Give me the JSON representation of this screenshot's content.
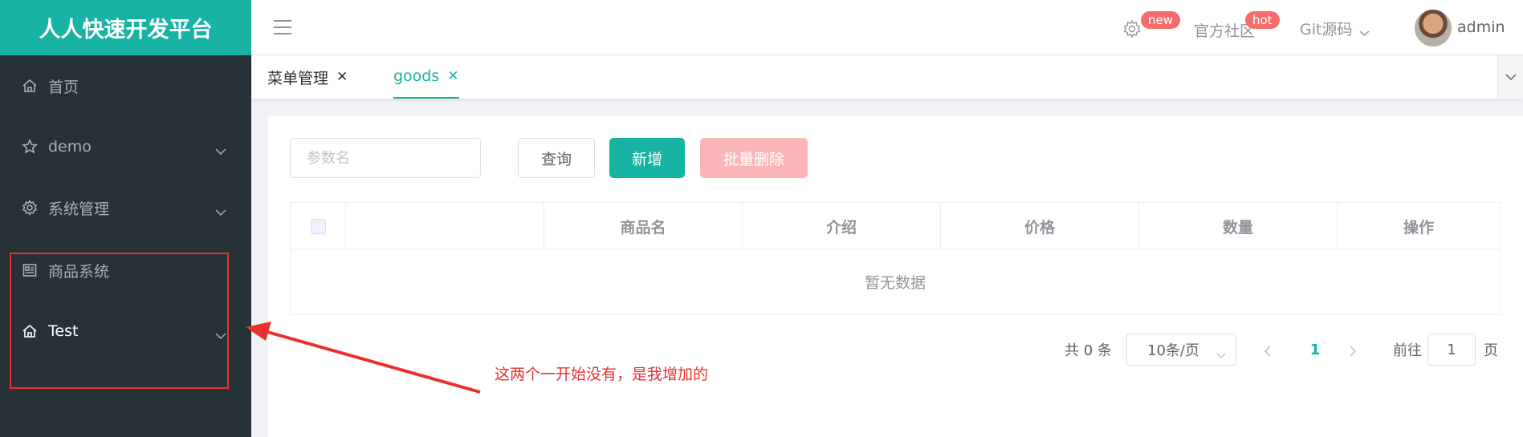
{
  "app": {
    "title": "人人快速开发平台"
  },
  "sidebar": {
    "items": [
      {
        "label": "首页",
        "icon": "home-icon",
        "has_children": false
      },
      {
        "label": "demo",
        "icon": "star-icon",
        "has_children": true
      },
      {
        "label": "系统管理",
        "icon": "gear-icon",
        "has_children": true
      },
      {
        "label": "商品系统",
        "icon": "product-card-icon",
        "has_children": false
      },
      {
        "label": "Test",
        "icon": "home-icon",
        "has_children": true
      }
    ]
  },
  "header": {
    "settings_badge": "new",
    "community_label": "官方社区",
    "community_badge": "hot",
    "git_label": "Git源码",
    "username": "admin"
  },
  "tabs": [
    {
      "label": "菜单管理",
      "active": false
    },
    {
      "label": "goods",
      "active": true
    }
  ],
  "search": {
    "placeholder": "参数名",
    "value": ""
  },
  "toolbar": {
    "query_label": "查询",
    "add_label": "新增",
    "batch_delete_label": "批量删除"
  },
  "table": {
    "columns": [
      "",
      "商品名",
      "介绍",
      "价格",
      "数量",
      "操作"
    ],
    "empty_text": "暂无数据"
  },
  "pagination": {
    "total_text": "共 0 条",
    "page_size": "10条/页",
    "current_page": "1",
    "goto_prefix": "前往",
    "goto_value": "1",
    "goto_suffix": "页"
  },
  "annotation": {
    "text": "这两个一开始没有，是我增加的",
    "color": "#e8312f"
  },
  "colors": {
    "brand": "#17b3a3",
    "sidebar_bg": "#263238",
    "danger": "#f56c6c",
    "danger_light": "#fab6b6"
  }
}
